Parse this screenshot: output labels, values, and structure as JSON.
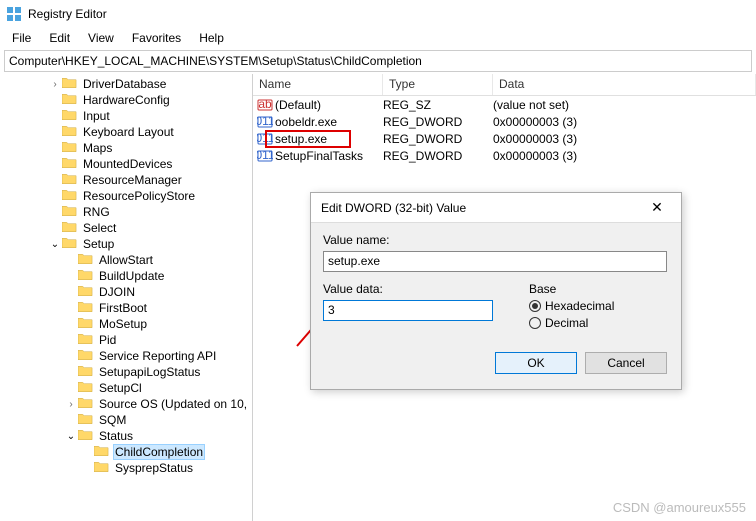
{
  "window": {
    "title": "Registry Editor"
  },
  "menu": {
    "file": "File",
    "edit": "Edit",
    "view": "View",
    "favorites": "Favorites",
    "help": "Help"
  },
  "path": "Computer\\HKEY_LOCAL_MACHINE\\SYSTEM\\Setup\\Status\\ChildCompletion",
  "tree": {
    "items": [
      {
        "d": 3,
        "c": "r",
        "l": "DriverDatabase"
      },
      {
        "d": 3,
        "c": "",
        "l": "HardwareConfig"
      },
      {
        "d": 3,
        "c": "",
        "l": "Input"
      },
      {
        "d": 3,
        "c": "",
        "l": "Keyboard Layout"
      },
      {
        "d": 3,
        "c": "",
        "l": "Maps"
      },
      {
        "d": 3,
        "c": "",
        "l": "MountedDevices"
      },
      {
        "d": 3,
        "c": "",
        "l": "ResourceManager"
      },
      {
        "d": 3,
        "c": "",
        "l": "ResourcePolicyStore"
      },
      {
        "d": 3,
        "c": "",
        "l": "RNG"
      },
      {
        "d": 3,
        "c": "",
        "l": "Select"
      },
      {
        "d": 3,
        "c": "o",
        "l": "Setup"
      },
      {
        "d": 4,
        "c": "",
        "l": "AllowStart"
      },
      {
        "d": 4,
        "c": "",
        "l": "BuildUpdate"
      },
      {
        "d": 4,
        "c": "",
        "l": "DJOIN"
      },
      {
        "d": 4,
        "c": "",
        "l": "FirstBoot"
      },
      {
        "d": 4,
        "c": "",
        "l": "MoSetup"
      },
      {
        "d": 4,
        "c": "",
        "l": "Pid"
      },
      {
        "d": 4,
        "c": "",
        "l": "Service Reporting API"
      },
      {
        "d": 4,
        "c": "",
        "l": "SetupapiLogStatus"
      },
      {
        "d": 4,
        "c": "",
        "l": "SetupCl"
      },
      {
        "d": 4,
        "c": "r",
        "l": "Source OS (Updated on 10,"
      },
      {
        "d": 4,
        "c": "",
        "l": "SQM"
      },
      {
        "d": 4,
        "c": "o",
        "l": "Status"
      },
      {
        "d": 5,
        "c": "",
        "l": "ChildCompletion",
        "sel": true
      },
      {
        "d": 5,
        "c": "",
        "l": "SysprepStatus"
      }
    ]
  },
  "list": {
    "head": {
      "name": "Name",
      "type": "Type",
      "data": "Data"
    },
    "rows": [
      {
        "icon": "str",
        "name": "(Default)",
        "type": "REG_SZ",
        "data": "(value not set)"
      },
      {
        "icon": "bin",
        "name": "oobeldr.exe",
        "type": "REG_DWORD",
        "data": "0x00000003 (3)"
      },
      {
        "icon": "bin",
        "name": "setup.exe",
        "type": "REG_DWORD",
        "data": "0x00000003 (3)"
      },
      {
        "icon": "bin",
        "name": "SetupFinalTasks",
        "type": "REG_DWORD",
        "data": "0x00000003 (3)"
      }
    ]
  },
  "dialog": {
    "title": "Edit DWORD (32-bit) Value",
    "name_label": "Value name:",
    "name_value": "setup.exe",
    "data_label": "Value data:",
    "data_value": "3",
    "base_label": "Base",
    "hex": "Hexadecimal",
    "dec": "Decimal",
    "ok": "OK",
    "cancel": "Cancel"
  },
  "watermark": "CSDN @amoureux555"
}
